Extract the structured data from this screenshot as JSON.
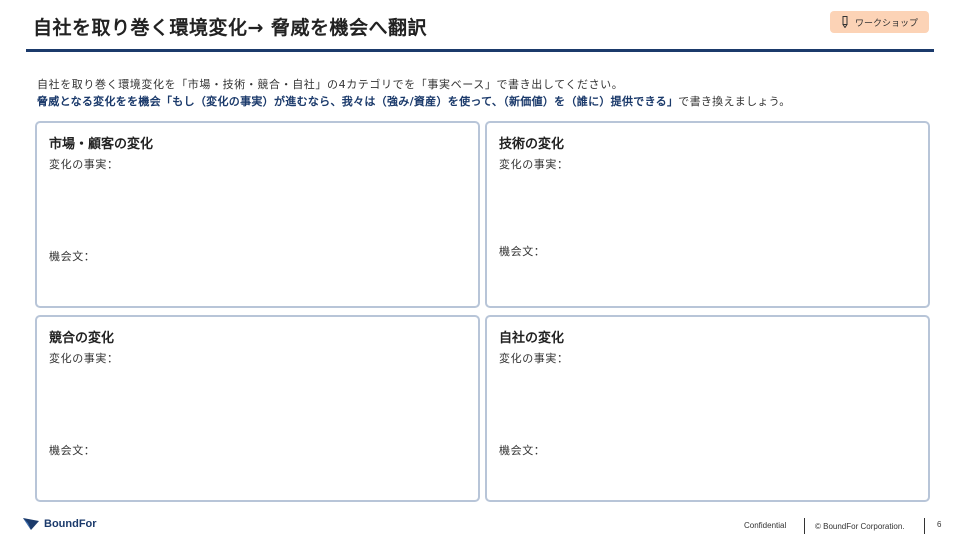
{
  "header": {
    "title": "自社を取り巻く環境変化→ 脅威を機会へ翻訳",
    "badge_label": "ワークショップ",
    "badge_icon": "pencil-icon"
  },
  "intro": {
    "line1": "自社を取り巻く環境変化を「市場・技術・競合・自社」の4カテゴリでを「事実ベース」で書き出してください。",
    "line2_strong": "脅威となる変化をを機会「もし（変化の事実）が進むなら、我々は（強み/資産）を使って、（新価値）を（誰に）提供できる」",
    "line2_rest": "で書き換えましょう。"
  },
  "cards": [
    {
      "heading": "市場・顧客の変化",
      "fact_label": "変化の事実：",
      "opportunity_label": "機会文："
    },
    {
      "heading": "技術の変化",
      "fact_label": "変化の事実：",
      "opportunity_label": "機会文："
    },
    {
      "heading": "競合の変化",
      "fact_label": "変化の事実：",
      "opportunity_label": "機会文："
    },
    {
      "heading": "自社の変化",
      "fact_label": "変化の事実：",
      "opportunity_label": "機会文："
    }
  ],
  "footer": {
    "logo_text": "BoundFor",
    "confidential": "Confidential",
    "copyright": "© BoundFor Corporation.",
    "page_number": "6"
  },
  "colors": {
    "accent_navy": "#1b3a6b",
    "badge_bg": "#fcd3b6",
    "card_border": "#b8c5d8"
  }
}
